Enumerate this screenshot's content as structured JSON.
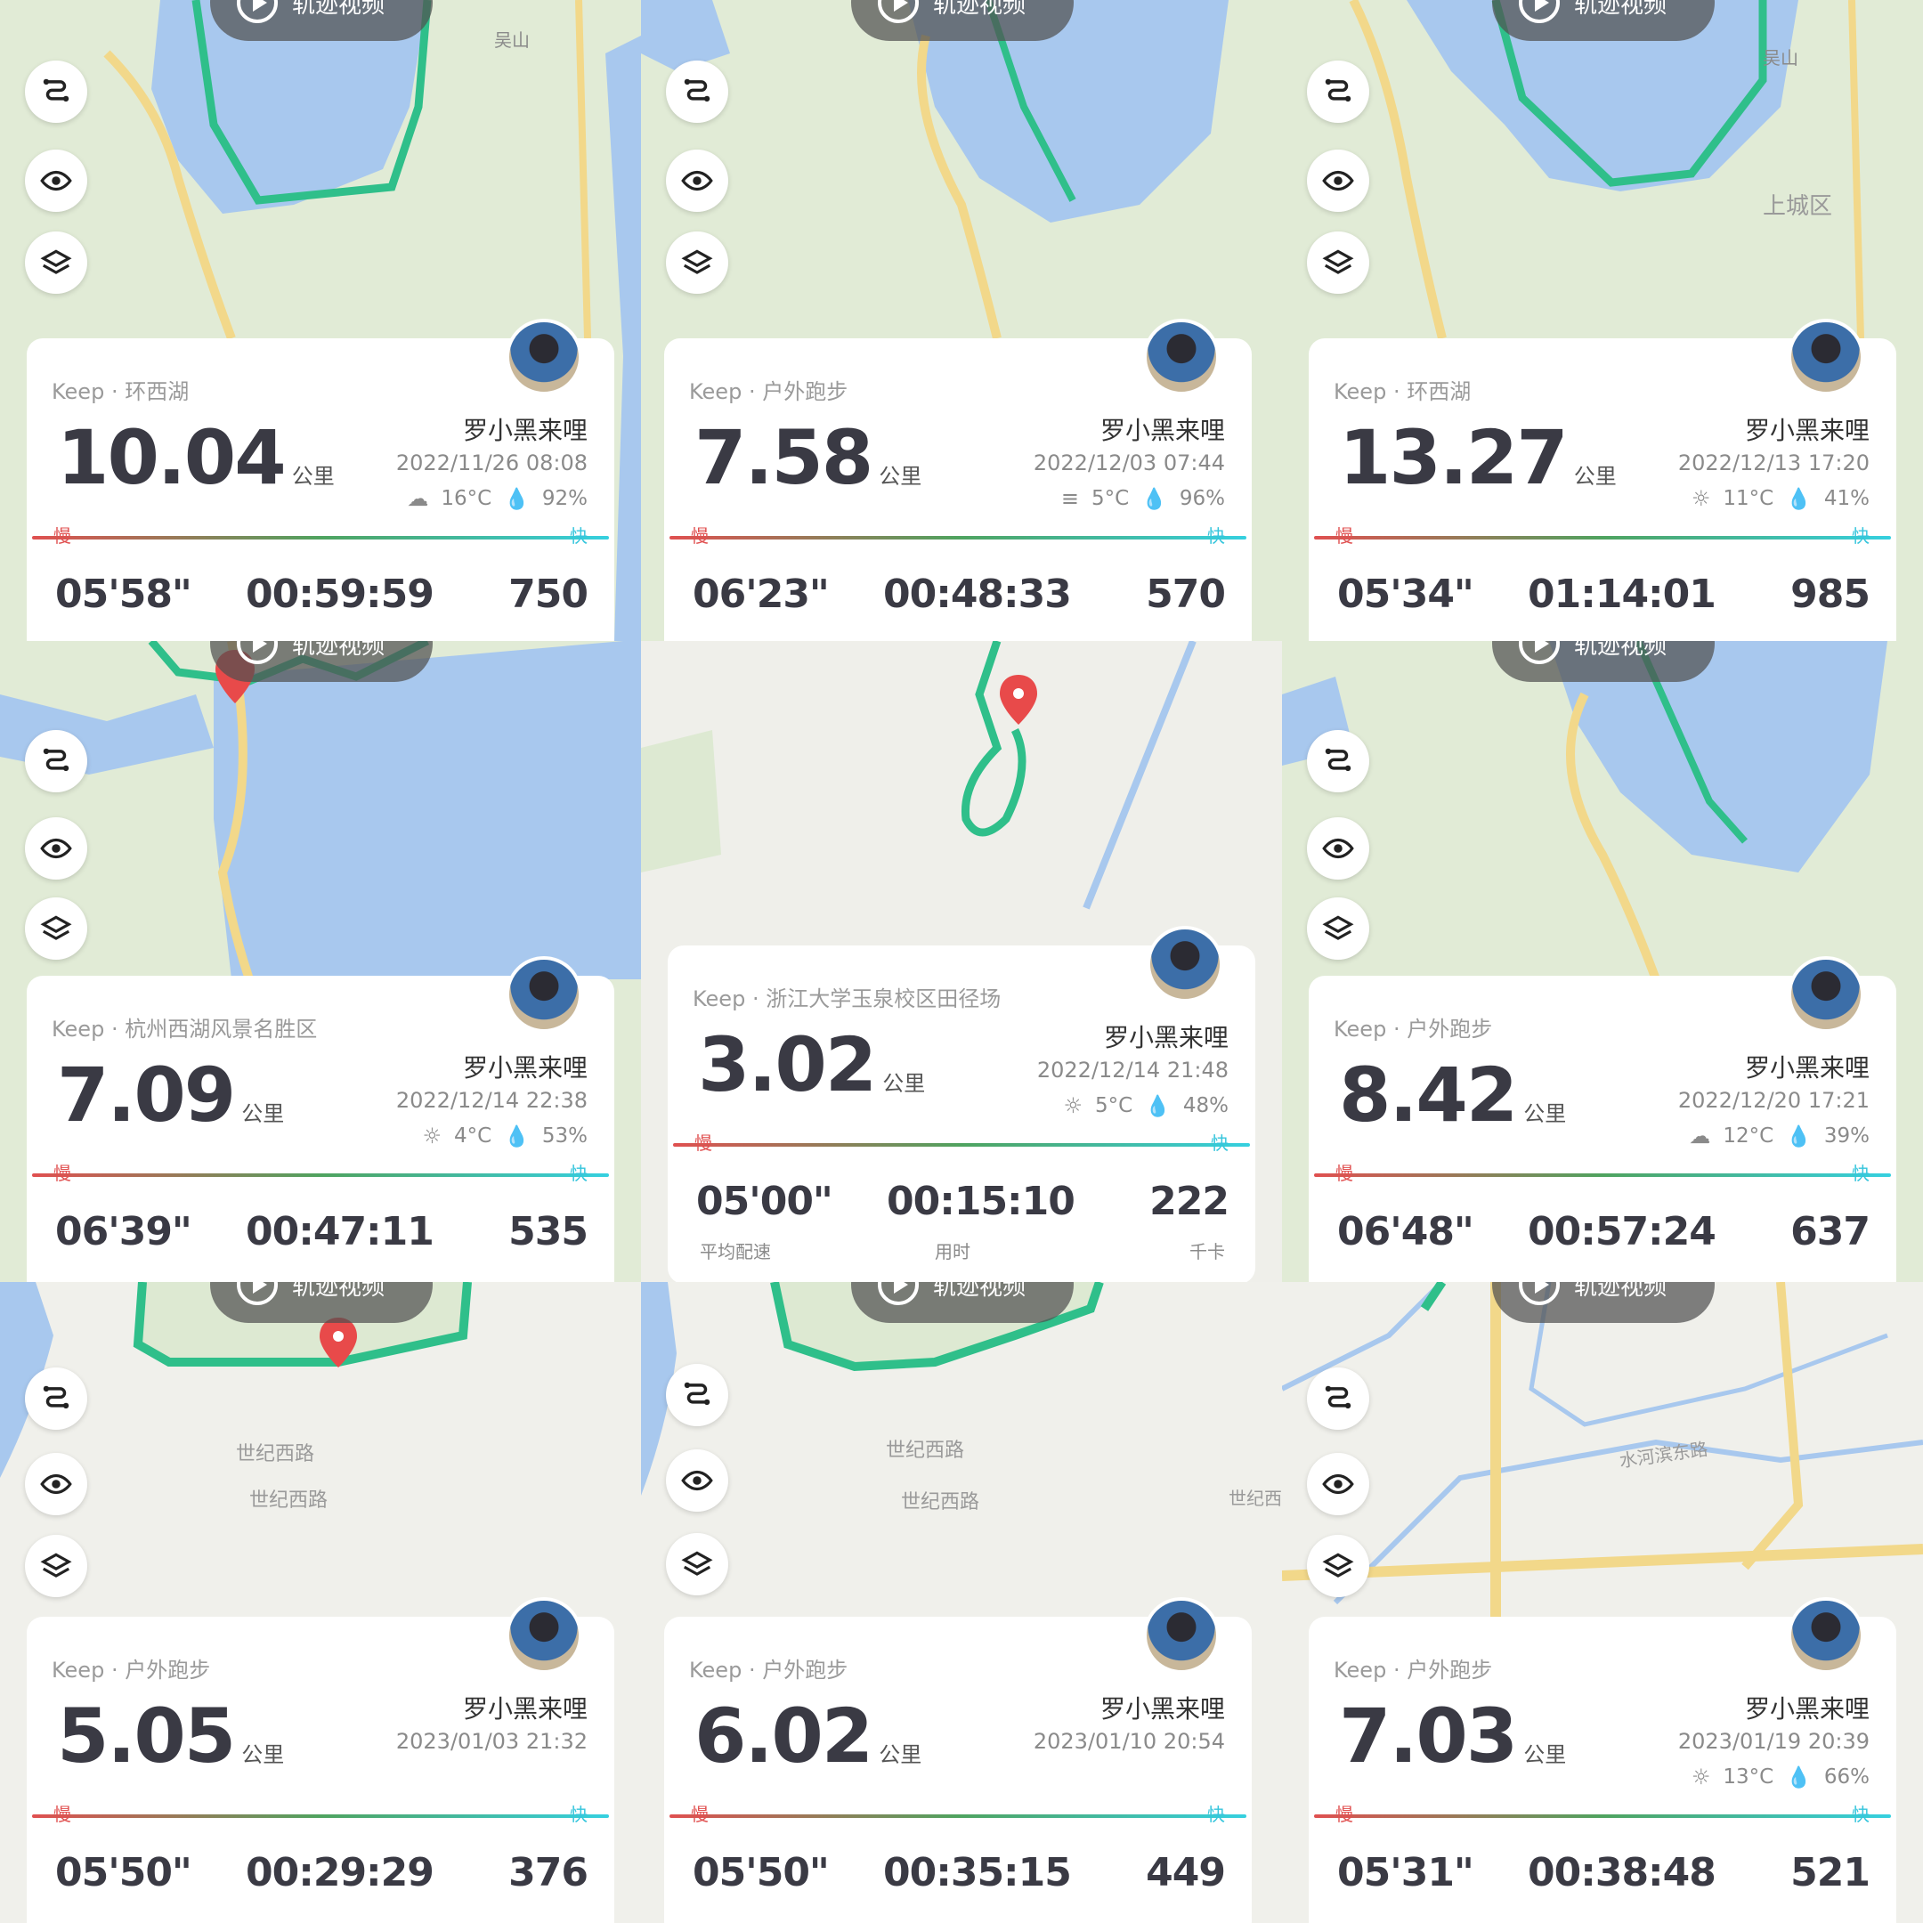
{
  "replay_label": "轨迹视频",
  "speed_scale": {
    "slow": "慢",
    "fast": "快"
  },
  "stat_labels": {
    "pace": "平均配速",
    "duration": "用时",
    "calories": "千卡"
  },
  "icons": [
    "route-icon",
    "eye-icon",
    "layers-icon",
    "play-icon",
    "weather-icon",
    "humidity-icon"
  ],
  "colors": {
    "route": "#2fbf8a",
    "water": "#a8c8ee",
    "land": "#e1ebd6",
    "pin": "#e84a4a",
    "fast": "#35d0e0",
    "slow": "#e05050"
  },
  "cards": [
    {
      "source": "Keep · 环西湖",
      "distance": "10.04",
      "unit": "公里",
      "user": "罗小黑来哩",
      "date": "2022/11/26 08:08",
      "weather_icon": "☁",
      "temp": "16°C",
      "humidity": "92%",
      "pace": "05'58\"",
      "duration": "00:59:59",
      "calories": "750"
    },
    {
      "source": "Keep · 户外跑步",
      "distance": "7.58",
      "unit": "公里",
      "user": "罗小黑来哩",
      "date": "2022/12/03 07:44",
      "weather_icon": "≡",
      "temp": "5°C",
      "humidity": "96%",
      "pace": "06'23\"",
      "duration": "00:48:33",
      "calories": "570"
    },
    {
      "source": "Keep · 环西湖",
      "distance": "13.27",
      "unit": "公里",
      "user": "罗小黑来哩",
      "date": "2022/12/13 17:20",
      "weather_icon": "☼",
      "temp": "11°C",
      "humidity": "41%",
      "pace": "05'34\"",
      "duration": "01:14:01",
      "calories": "985"
    },
    {
      "source": "Keep · 杭州西湖风景名胜区",
      "distance": "7.09",
      "unit": "公里",
      "user": "罗小黑来哩",
      "date": "2022/12/14 22:38",
      "weather_icon": "☼",
      "temp": "4°C",
      "humidity": "53%",
      "pace": "06'39\"",
      "duration": "00:47:11",
      "calories": "535"
    },
    {
      "source": "Keep · 浙江大学玉泉校区田径场",
      "distance": "3.02",
      "unit": "公里",
      "user": "罗小黑来哩",
      "date": "2022/12/14 21:48",
      "weather_icon": "☼",
      "temp": "5°C",
      "humidity": "48%",
      "pace": "05'00\"",
      "duration": "00:15:10",
      "calories": "222"
    },
    {
      "source": "Keep · 户外跑步",
      "distance": "8.42",
      "unit": "公里",
      "user": "罗小黑来哩",
      "date": "2022/12/20 17:21",
      "weather_icon": "☁",
      "temp": "12°C",
      "humidity": "39%",
      "pace": "06'48\"",
      "duration": "00:57:24",
      "calories": "637"
    },
    {
      "source": "Keep · 户外跑步",
      "distance": "5.05",
      "unit": "公里",
      "user": "罗小黑来哩",
      "date": "2023/01/03 21:32",
      "weather_icon": "",
      "temp": "",
      "humidity": "",
      "pace": "05'50\"",
      "duration": "00:29:29",
      "calories": "376"
    },
    {
      "source": "Keep · 户外跑步",
      "distance": "6.02",
      "unit": "公里",
      "user": "罗小黑来哩",
      "date": "2023/01/10 20:54",
      "weather_icon": "",
      "temp": "",
      "humidity": "",
      "pace": "05'50\"",
      "duration": "00:35:15",
      "calories": "449"
    },
    {
      "source": "Keep · 户外跑步",
      "distance": "7.03",
      "unit": "公里",
      "user": "罗小黑来哩",
      "date": "2023/01/19 20:39",
      "weather_icon": "☼",
      "temp": "13°C",
      "humidity": "66%",
      "pace": "05'31\"",
      "duration": "00:38:48",
      "calories": "521"
    }
  ],
  "map_labels": {
    "wushan": "吴山",
    "shangcheng": "上城区",
    "shiji1": "世纪西路",
    "shiji2": "世纪西路",
    "shiji3": "世纪西",
    "shuihe": "水河滨东路"
  }
}
